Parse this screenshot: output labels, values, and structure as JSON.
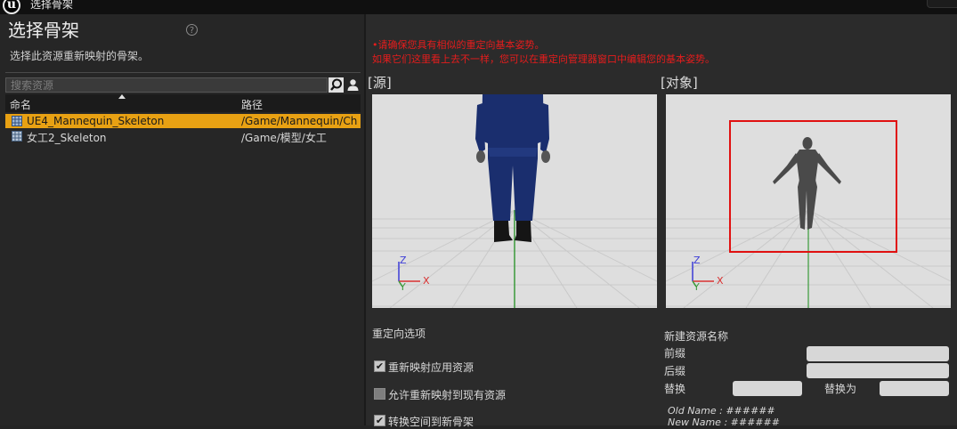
{
  "window": {
    "title": "选择骨架"
  },
  "left": {
    "heading": "选择骨架",
    "subtitle": "选择此资源重新映射的骨架。",
    "search_placeholder": "搜索资源",
    "columns": {
      "name": "命名",
      "path": "路径"
    },
    "rows": [
      {
        "name": "UE4_Mannequin_Skeleton",
        "path": "/Game/Mannequin/Cha",
        "selected": true
      },
      {
        "name": "女工2_Skeleton",
        "path": "/Game/模型/女工",
        "selected": false
      }
    ]
  },
  "right": {
    "warning_line1": "•请确保您具有相似的重定向基本姿势。",
    "warning_line2": "如果它们这里看上去不一样，您可以在重定向管理器窗口中编辑您的基本姿势。",
    "source_label": "[源]",
    "target_label": "[对象]",
    "axes": {
      "z": "Z",
      "y": "Y",
      "x": "X"
    },
    "retarget_options_title": "重定向选项",
    "options": [
      {
        "label": "重新映射应用资源",
        "checked": true
      },
      {
        "label": "允许重新映射到现有资源",
        "checked": false
      },
      {
        "label": "转换空间到新骨架",
        "checked": true
      }
    ],
    "new_asset": {
      "title": "新建资源名称",
      "prefix_label": "前缀",
      "prefix_value": "",
      "suffix_label": "后缀",
      "suffix_value": "",
      "replace_label": "替换",
      "replace_value": "",
      "replace_with_label": "替换为",
      "replace_with_value": "",
      "old_name": "Old Name : ######",
      "new_name": "New Name : ######"
    }
  },
  "colors": {
    "selection": "#e8a113",
    "warning": "#e51c1c",
    "target_box": "#e01010"
  }
}
